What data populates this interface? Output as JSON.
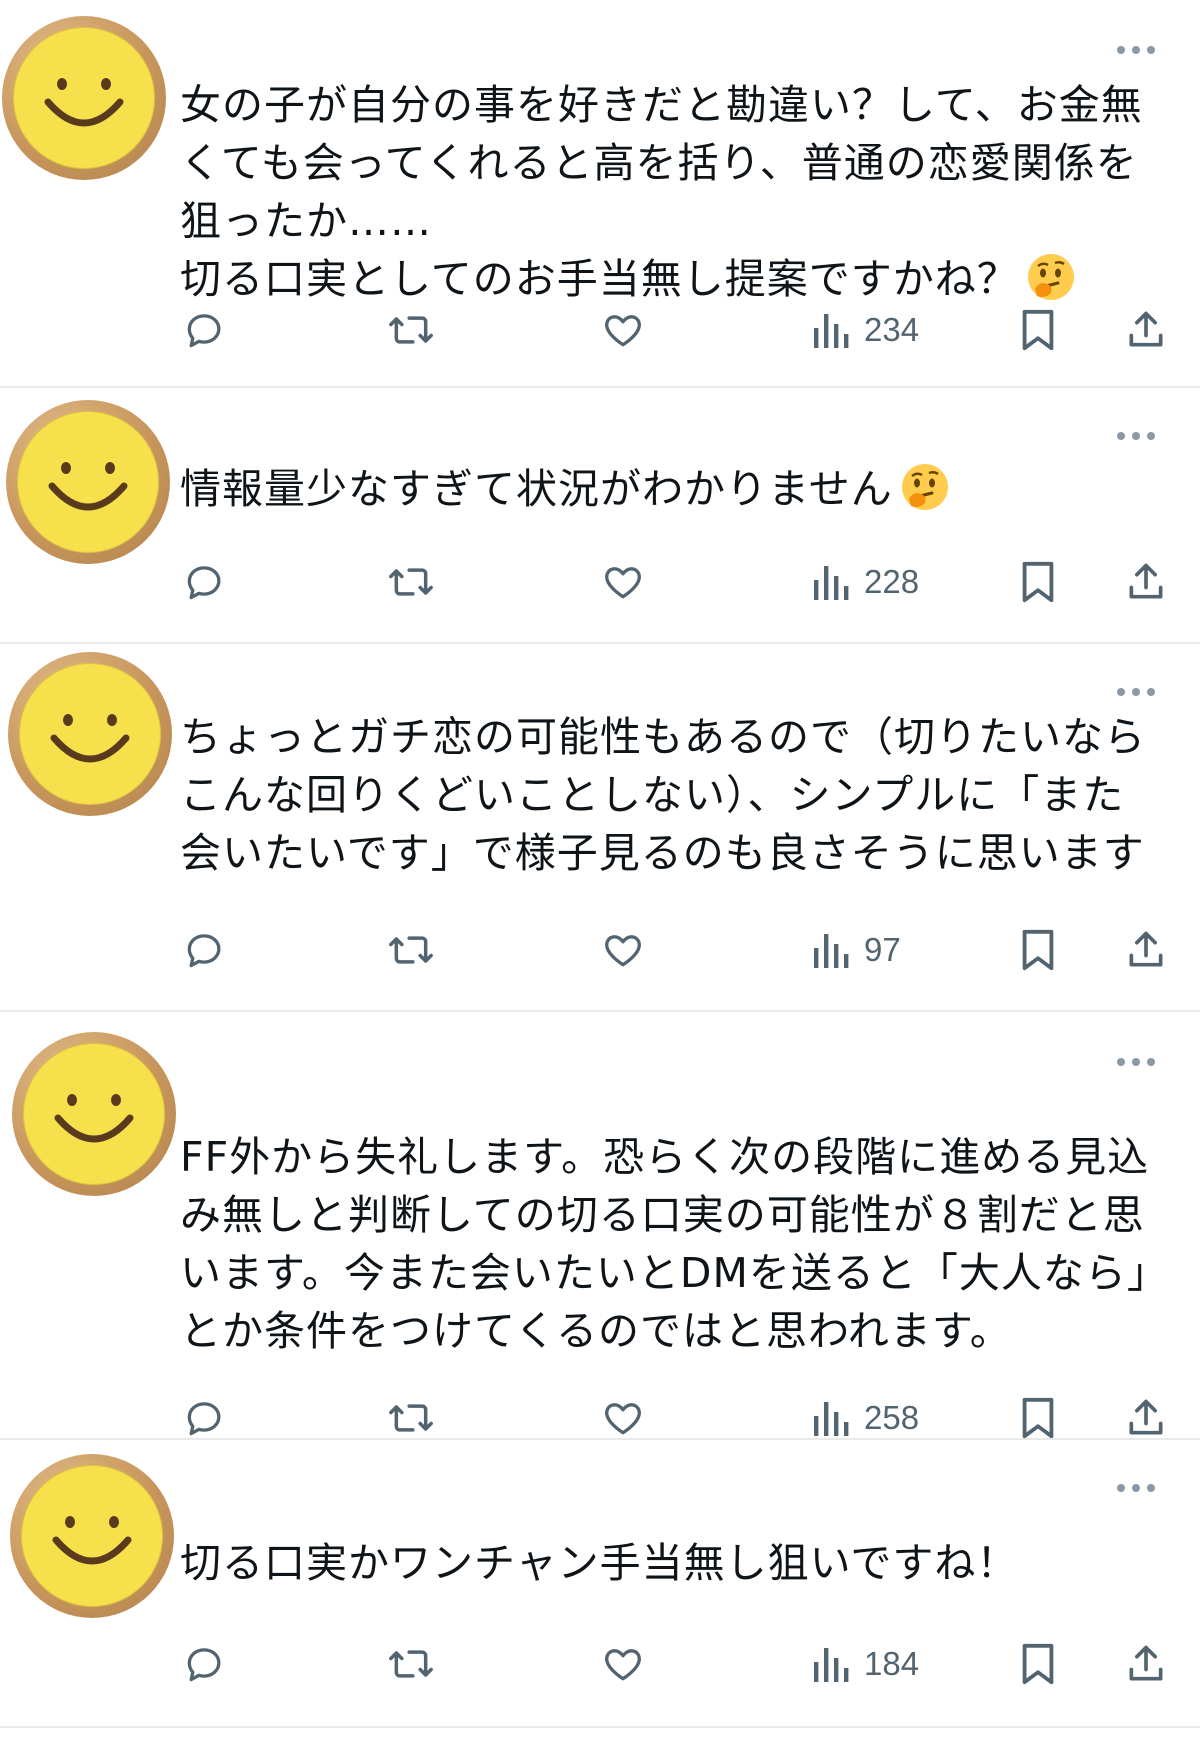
{
  "replies": [
    {
      "text": "女の子が自分の事を好きだと勘違い？して、お金無\nくても会ってくれると高を括り、普通の恋愛関係を\n狙ったか……\n切る口実としてのお手当無し提案ですかね？",
      "emoji": "thinking-face",
      "views": "234"
    },
    {
      "text": "情報量少なすぎて状況がわかりません",
      "emoji": "thinking-face",
      "views": "228"
    },
    {
      "text": "ちょっとガチ恋の可能性もあるので（切りたいなら\nこんな回りくどいことしない）、シンプルに「また\n会いたいです」で様子見るのも良さそうに思います",
      "views": "97"
    },
    {
      "text": "FF外から失礼します。恐らく次の段階に進める見込\nみ無しと判断しての切る口実の可能性が８割だと思\nいます。今また会いたいとDMを送ると「大人なら」\nとか条件をつけてくるのではと思われます。",
      "views": "258"
    },
    {
      "text": "切る口実かワンチャン手当無し狙いですね！",
      "views": "184"
    }
  ],
  "icons": {
    "avatar": "smiley-face-icon",
    "more": "more-dots-icon",
    "reply": "reply-icon",
    "repost": "repost-icon",
    "like": "like-icon",
    "views": "views-icon",
    "bookmark": "bookmark-icon",
    "share": "share-icon"
  },
  "colors": {
    "text": "#0f1419",
    "secondary": "#536471",
    "divider": "#e7e9ea",
    "avatar_face": "#f6e04c",
    "avatar_ring": "#c8965c"
  }
}
